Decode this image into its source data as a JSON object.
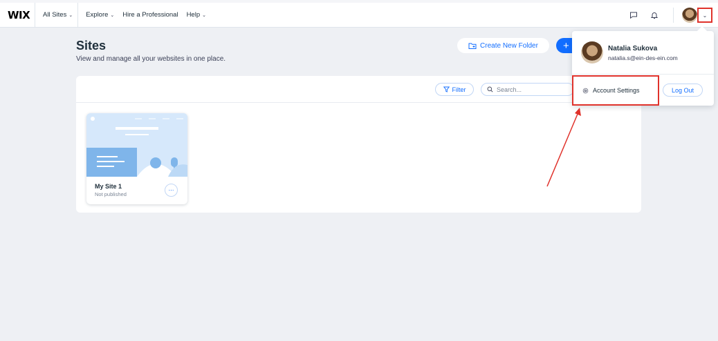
{
  "topbar": {
    "logo": "WIX",
    "all_sites": "All Sites",
    "explore": "Explore",
    "hire": "Hire a Professional",
    "help": "Help"
  },
  "header": {
    "title": "Sites",
    "subtitle": "View and manage all your websites in one place.",
    "create_folder": "Create New Folder",
    "create_site_icon": "+"
  },
  "toolbar": {
    "filter": "Filter",
    "search_placeholder": "Search..."
  },
  "sites": [
    {
      "name": "My Site 1",
      "status": "Not published"
    }
  ],
  "dropdown": {
    "user_name": "Natalia Sukova",
    "user_email": "natalia.s@ein-des-ein.com",
    "account_settings": "Account Settings",
    "logout": "Log Out"
  },
  "colors": {
    "accent": "#116dff",
    "highlight": "#e0322b",
    "background": "#eef0f4"
  },
  "icons": [
    "chevron-down-icon",
    "chat-icon",
    "bell-icon",
    "folder-plus-icon",
    "filter-icon",
    "search-icon",
    "gear-icon",
    "more-icon"
  ]
}
